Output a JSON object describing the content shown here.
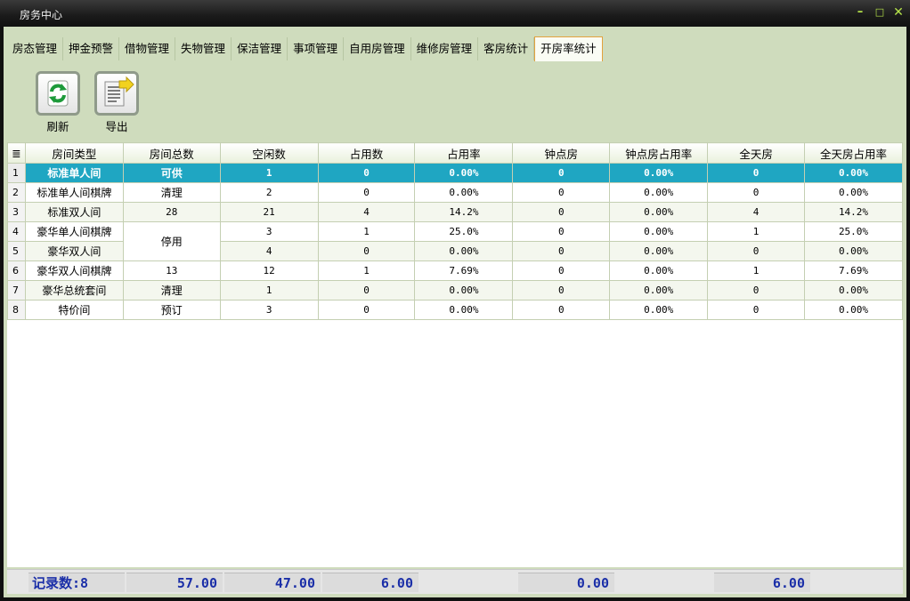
{
  "window": {
    "title": "房务中心",
    "min_glyph": "–",
    "max_glyph": "□",
    "close_glyph": "✕"
  },
  "tabs": [
    {
      "label": "房态管理",
      "active": false
    },
    {
      "label": "押金预警",
      "active": false
    },
    {
      "label": "借物管理",
      "active": false
    },
    {
      "label": "失物管理",
      "active": false
    },
    {
      "label": "保洁管理",
      "active": false
    },
    {
      "label": "事项管理",
      "active": false
    },
    {
      "label": "自用房管理",
      "active": false
    },
    {
      "label": "维修房管理",
      "active": false
    },
    {
      "label": "客房统计",
      "active": false
    },
    {
      "label": "开房率统计",
      "active": true
    }
  ],
  "toolbar": {
    "refresh_label": "刷新",
    "refresh_icon": "refresh-icon",
    "export_label": "导出",
    "export_icon": "export-icon"
  },
  "grid": {
    "corner_icon": "≣",
    "columns": [
      "房间类型",
      "房间总数",
      "空闲数",
      "占用数",
      "占用率",
      "钟点房",
      "钟点房占用率",
      "全天房",
      "全天房占用率"
    ],
    "rows": [
      {
        "no": "1",
        "type": "标准单人间",
        "total": "可供",
        "free": "1",
        "used": "0",
        "rate": "0.00%",
        "hourly": "0",
        "hourly_rate": "0.00%",
        "fullday": "0",
        "fullday_rate": "0.00%"
      },
      {
        "no": "2",
        "type": "标准单人间棋牌",
        "total": "清理",
        "free": "2",
        "used": "0",
        "rate": "0.00%",
        "hourly": "0",
        "hourly_rate": "0.00%",
        "fullday": "0",
        "fullday_rate": "0.00%"
      },
      {
        "no": "3",
        "type": "标准双人间",
        "total": "28",
        "free": "21",
        "used": "4",
        "rate": "14.2%",
        "hourly": "0",
        "hourly_rate": "0.00%",
        "fullday": "4",
        "fullday_rate": "14.2%"
      },
      {
        "no": "4",
        "type": "豪华单人间棋牌",
        "total": "停用",
        "free": "3",
        "used": "1",
        "rate": "25.0%",
        "hourly": "0",
        "hourly_rate": "0.00%",
        "fullday": "1",
        "fullday_rate": "25.0%"
      },
      {
        "no": "5",
        "type": "豪华双人间",
        "total": "",
        "free": "4",
        "used": "0",
        "rate": "0.00%",
        "hourly": "0",
        "hourly_rate": "0.00%",
        "fullday": "0",
        "fullday_rate": "0.00%"
      },
      {
        "no": "6",
        "type": "豪华双人间棋牌",
        "total": "13",
        "free": "12",
        "used": "1",
        "rate": "7.69%",
        "hourly": "0",
        "hourly_rate": "0.00%",
        "fullday": "1",
        "fullday_rate": "7.69%"
      },
      {
        "no": "7",
        "type": "豪华总统套间",
        "total": "清理",
        "free": "1",
        "used": "0",
        "rate": "0.00%",
        "hourly": "0",
        "hourly_rate": "0.00%",
        "fullday": "0",
        "fullday_rate": "0.00%"
      },
      {
        "no": "8",
        "type": "特价间",
        "total": "预订",
        "free": "3",
        "used": "0",
        "rate": "0.00%",
        "hourly": "0",
        "hourly_rate": "0.00%",
        "fullday": "0",
        "fullday_rate": "0.00%"
      }
    ],
    "selected_row": "1"
  },
  "footer": {
    "record_count": "记录数:8",
    "total_sum": "57.00",
    "free_sum": "47.00",
    "used_sum": "6.00",
    "hourly_sum": "0.00",
    "fullday_sum": "6.00"
  }
}
